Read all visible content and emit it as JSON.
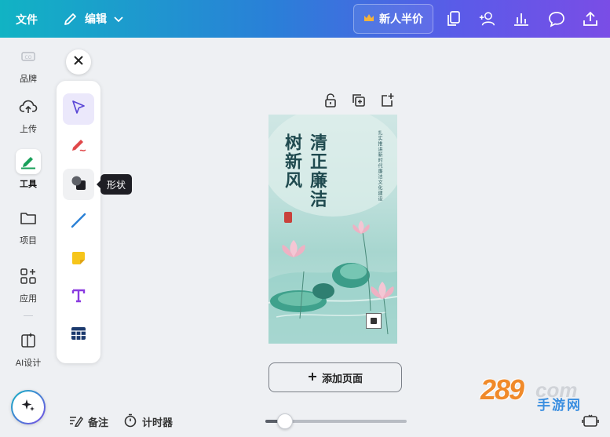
{
  "topbar": {
    "file_label": "文件",
    "edit_label": "编辑",
    "promo_label": "新人半价",
    "icons": [
      "copy-pages-icon",
      "share-people-icon",
      "analytics-icon",
      "comment-icon",
      "upload-icon"
    ]
  },
  "sidebar": {
    "items": [
      {
        "label": "品牌",
        "icon": "brand-icon"
      },
      {
        "label": "上传",
        "icon": "cloud-upload-icon"
      },
      {
        "label": "工具",
        "icon": "pen-tool-icon",
        "active": true
      },
      {
        "label": "项目",
        "icon": "folder-icon"
      },
      {
        "label": "应用",
        "icon": "apps-grid-icon"
      },
      {
        "label": "AI设计",
        "icon": "ai-design-icon"
      }
    ],
    "magic_icon": "sparkle-icon"
  },
  "tools": {
    "items": [
      {
        "name": "select",
        "icon": "cursor-arrow-icon",
        "selected": true
      },
      {
        "name": "draw",
        "icon": "pen-draw-icon"
      },
      {
        "name": "shape",
        "icon": "shape-icon",
        "hover": true
      },
      {
        "name": "line",
        "icon": "line-icon"
      },
      {
        "name": "sticky",
        "icon": "sticky-note-icon"
      },
      {
        "name": "text",
        "icon": "text-icon"
      },
      {
        "name": "table",
        "icon": "table-icon"
      }
    ],
    "tooltip": "形状"
  },
  "page_actions": [
    "lock-icon",
    "duplicate-page-icon",
    "add-page-icon"
  ],
  "poster": {
    "title_right": "清正廉洁",
    "title_left": "树新风",
    "subtitle": "扎实推进新时代廉洁文化建设"
  },
  "add_page_label": "添加页面",
  "bottom": {
    "notes_label": "备注",
    "timer_label": "计时器",
    "zoom_fraction": 0.14
  },
  "watermark": {
    "number": "289",
    "com": "com",
    "site": "手游网"
  },
  "colors": {
    "accent": "#7b5ce6",
    "topbar_start": "#11b3c4",
    "topbar_end": "#7a4de6",
    "tool_select": "#5a46d6",
    "pen_red": "#e0484a",
    "line_blue": "#2a80d6",
    "sticky_yellow": "#f6c51a",
    "text_purple": "#8a3be0",
    "table_navy": "#1c3a6e"
  }
}
